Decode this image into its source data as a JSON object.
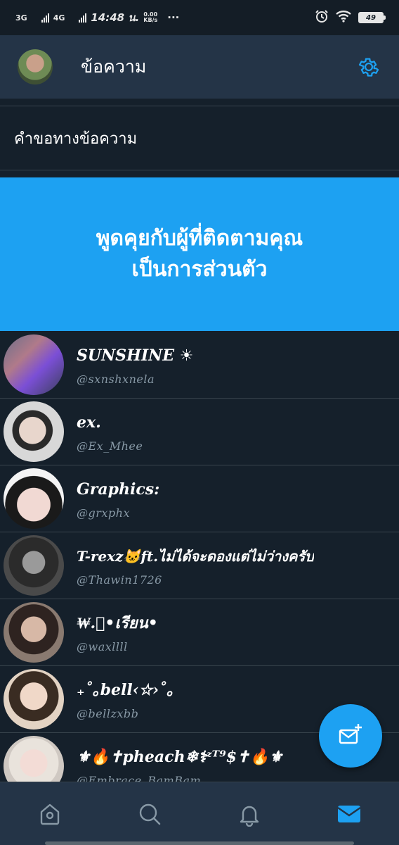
{
  "status_bar": {
    "network_1": "3G",
    "network_2": "4G",
    "time": "14:48 น.",
    "speed_value": "0.00",
    "speed_unit": "KB/s",
    "more": "···",
    "battery": "49"
  },
  "header": {
    "title": "ข้อความ"
  },
  "requests": {
    "label": "คำขอทางข้อความ"
  },
  "banner": {
    "line1": "พูดคุยกับผู้ที่ติดตามคุณ",
    "line2": "เป็นการส่วนตัว"
  },
  "conversations": [
    {
      "name": "SUNSHINE ☀",
      "handle": "@sxnshxnela"
    },
    {
      "name": "ex.",
      "handle": "@Ex_Mhee"
    },
    {
      "name": "Graphics:",
      "handle": "@grxphx"
    },
    {
      "name": "T-rexz🐱ft.ไม่ได้จะดองแต่ไม่ว่างครับ",
      "handle": "@Thawin1726"
    },
    {
      "name": "₩.ﾟ•เรียน•",
      "handle": "@waxllll"
    },
    {
      "name": "₊˚｡bell‹☆›˚｡",
      "handle": "@bellzxbb"
    },
    {
      "name": "⚜🔥✝pheach❄⚕ᶻᵀ⁹$✝🔥⚜",
      "handle": "@Embrace_BamBam"
    }
  ],
  "colors": {
    "accent": "#1da1f2",
    "background": "#15202b",
    "header": "#243447",
    "secondary_text": "#8899a6"
  },
  "icons": {
    "settings": "gear-icon",
    "compose": "new-message-icon",
    "nav": [
      "home-icon",
      "search-icon",
      "bell-icon",
      "mail-icon"
    ]
  }
}
